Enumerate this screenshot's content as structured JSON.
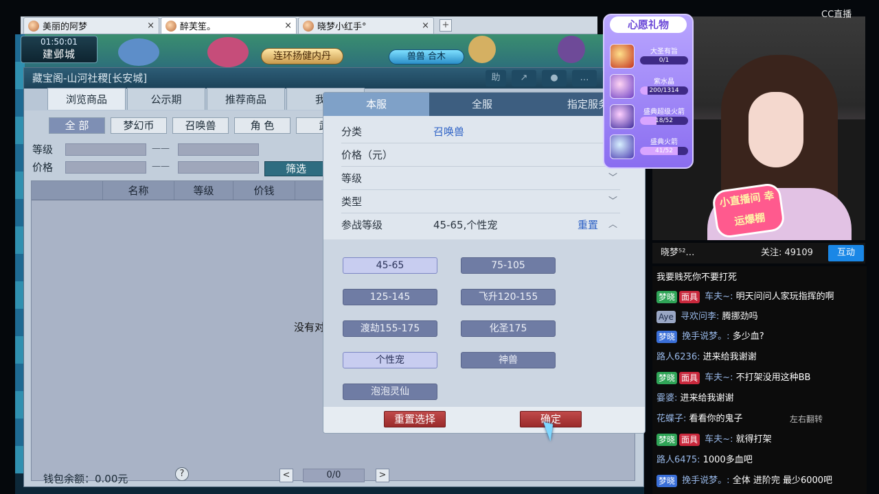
{
  "browser": {
    "tabs": [
      {
        "title": "美丽的阿梦",
        "close": "×"
      },
      {
        "title": "醉芙笙。",
        "close": "×"
      },
      {
        "title": "晓梦小红手°",
        "close": "×"
      }
    ],
    "new_tab": "+"
  },
  "scene": {
    "time": "01:50:01",
    "city": "建邺城",
    "quest": "连环扬健内丹",
    "pet_tag": "兽兽 合木"
  },
  "dialog": {
    "title": "藏宝阁-山河社稷[长安城]",
    "icons": {
      "help": "助",
      "share": "↗",
      "stop": "●",
      "chat": "…",
      "cart": "🛒"
    },
    "tabs": [
      "浏览商品",
      "公示期",
      "推荐商品",
      "我是"
    ],
    "categories": [
      "全 部",
      "梦幻币",
      "召唤兽",
      "角 色",
      "武"
    ],
    "level_label": "等级",
    "price_label": "价格",
    "range_dash": "——",
    "filter_button": "筛选",
    "columns": [
      "名称",
      "等级",
      "价钱"
    ],
    "empty_text": "没有对",
    "wallet": "钱包余额：0.00元",
    "help": "?",
    "page_prev": "<",
    "page_next": ">",
    "page_indicator": "0/0"
  },
  "panel": {
    "tabs": [
      "本服",
      "全服",
      "指定服务"
    ],
    "rows": [
      {
        "label": "分类",
        "value": "召唤兽"
      },
      {
        "label": "价格（元）",
        "value": ""
      },
      {
        "label": "等级",
        "chev": "﹀"
      },
      {
        "label": "类型",
        "chev": "﹀"
      },
      {
        "label": "参战等级",
        "value": "45-65,个性宠",
        "reset": "重置",
        "chev": "︿"
      }
    ],
    "options": [
      {
        "label": "45-65",
        "selected": true
      },
      {
        "label": "75-105",
        "selected": false
      },
      {
        "label": "125-145",
        "selected": false
      },
      {
        "label": "飞升120-155",
        "selected": false
      },
      {
        "label": "渡劫155-175",
        "selected": false
      },
      {
        "label": "化圣175",
        "selected": false
      },
      {
        "label": "个性宠",
        "selected": true
      },
      {
        "label": "神兽",
        "selected": false
      },
      {
        "label": "泡泡灵仙",
        "selected": false
      }
    ],
    "reset_button": "重置选择",
    "confirm_button": "确定"
  },
  "gift": {
    "title": "心愿礼物",
    "items": [
      {
        "name": "大圣有旨",
        "progress": "0/1",
        "fraction": 0.0
      },
      {
        "name": "紫水晶",
        "progress": "200/1314",
        "fraction": 0.152
      },
      {
        "name": "盛典超级火箭",
        "progress": "18/52",
        "fraction": 0.346
      },
      {
        "name": "盛典火箭",
        "progress": "41/52",
        "fraction": 0.788
      }
    ]
  },
  "stream": {
    "logo": "CC直播",
    "sticker": "小直播间 幸运爆棚",
    "anchor_name": "晓梦⁵²…",
    "follow": "关注: 49109",
    "hudong": "互动",
    "chat": [
      {
        "nick": "",
        "text": "我要贱死你不要打死",
        "tags": []
      },
      {
        "nick": "车夫~:",
        "text": "明天问问人家玩指挥的啊",
        "tags": [
          "梦晓",
          "面具"
        ]
      },
      {
        "nick": "寻欢问李:",
        "text": "腾挪劲吗",
        "tags": [
          "Aye"
        ]
      },
      {
        "nick": "挽手说梦。:",
        "text": "多少血?",
        "tags": [
          "梦晓"
        ]
      },
      {
        "nick": "路人6236:",
        "text": "进来给我谢谢",
        "tags": []
      },
      {
        "nick": "车夫~:",
        "text": "不打架没用这种BB",
        "tags": [
          "梦晓",
          "面具"
        ]
      },
      {
        "nick": "霎婆:",
        "text": "进来给我谢谢",
        "tags": []
      },
      {
        "nick": "花蝶子:",
        "text": "看看你的鬼子",
        "tags": []
      },
      {
        "nick": "车夫~:",
        "text": "就得打架",
        "tags": [
          "梦晓",
          "面具"
        ]
      },
      {
        "nick": "路人6475:",
        "text": "1000多血吧",
        "tags": []
      },
      {
        "nick": "挽手说梦。:",
        "text": "全体 进阶完 最少6000吧",
        "tags": [
          "梦晓"
        ]
      }
    ],
    "chat_options": "左右翻转"
  }
}
